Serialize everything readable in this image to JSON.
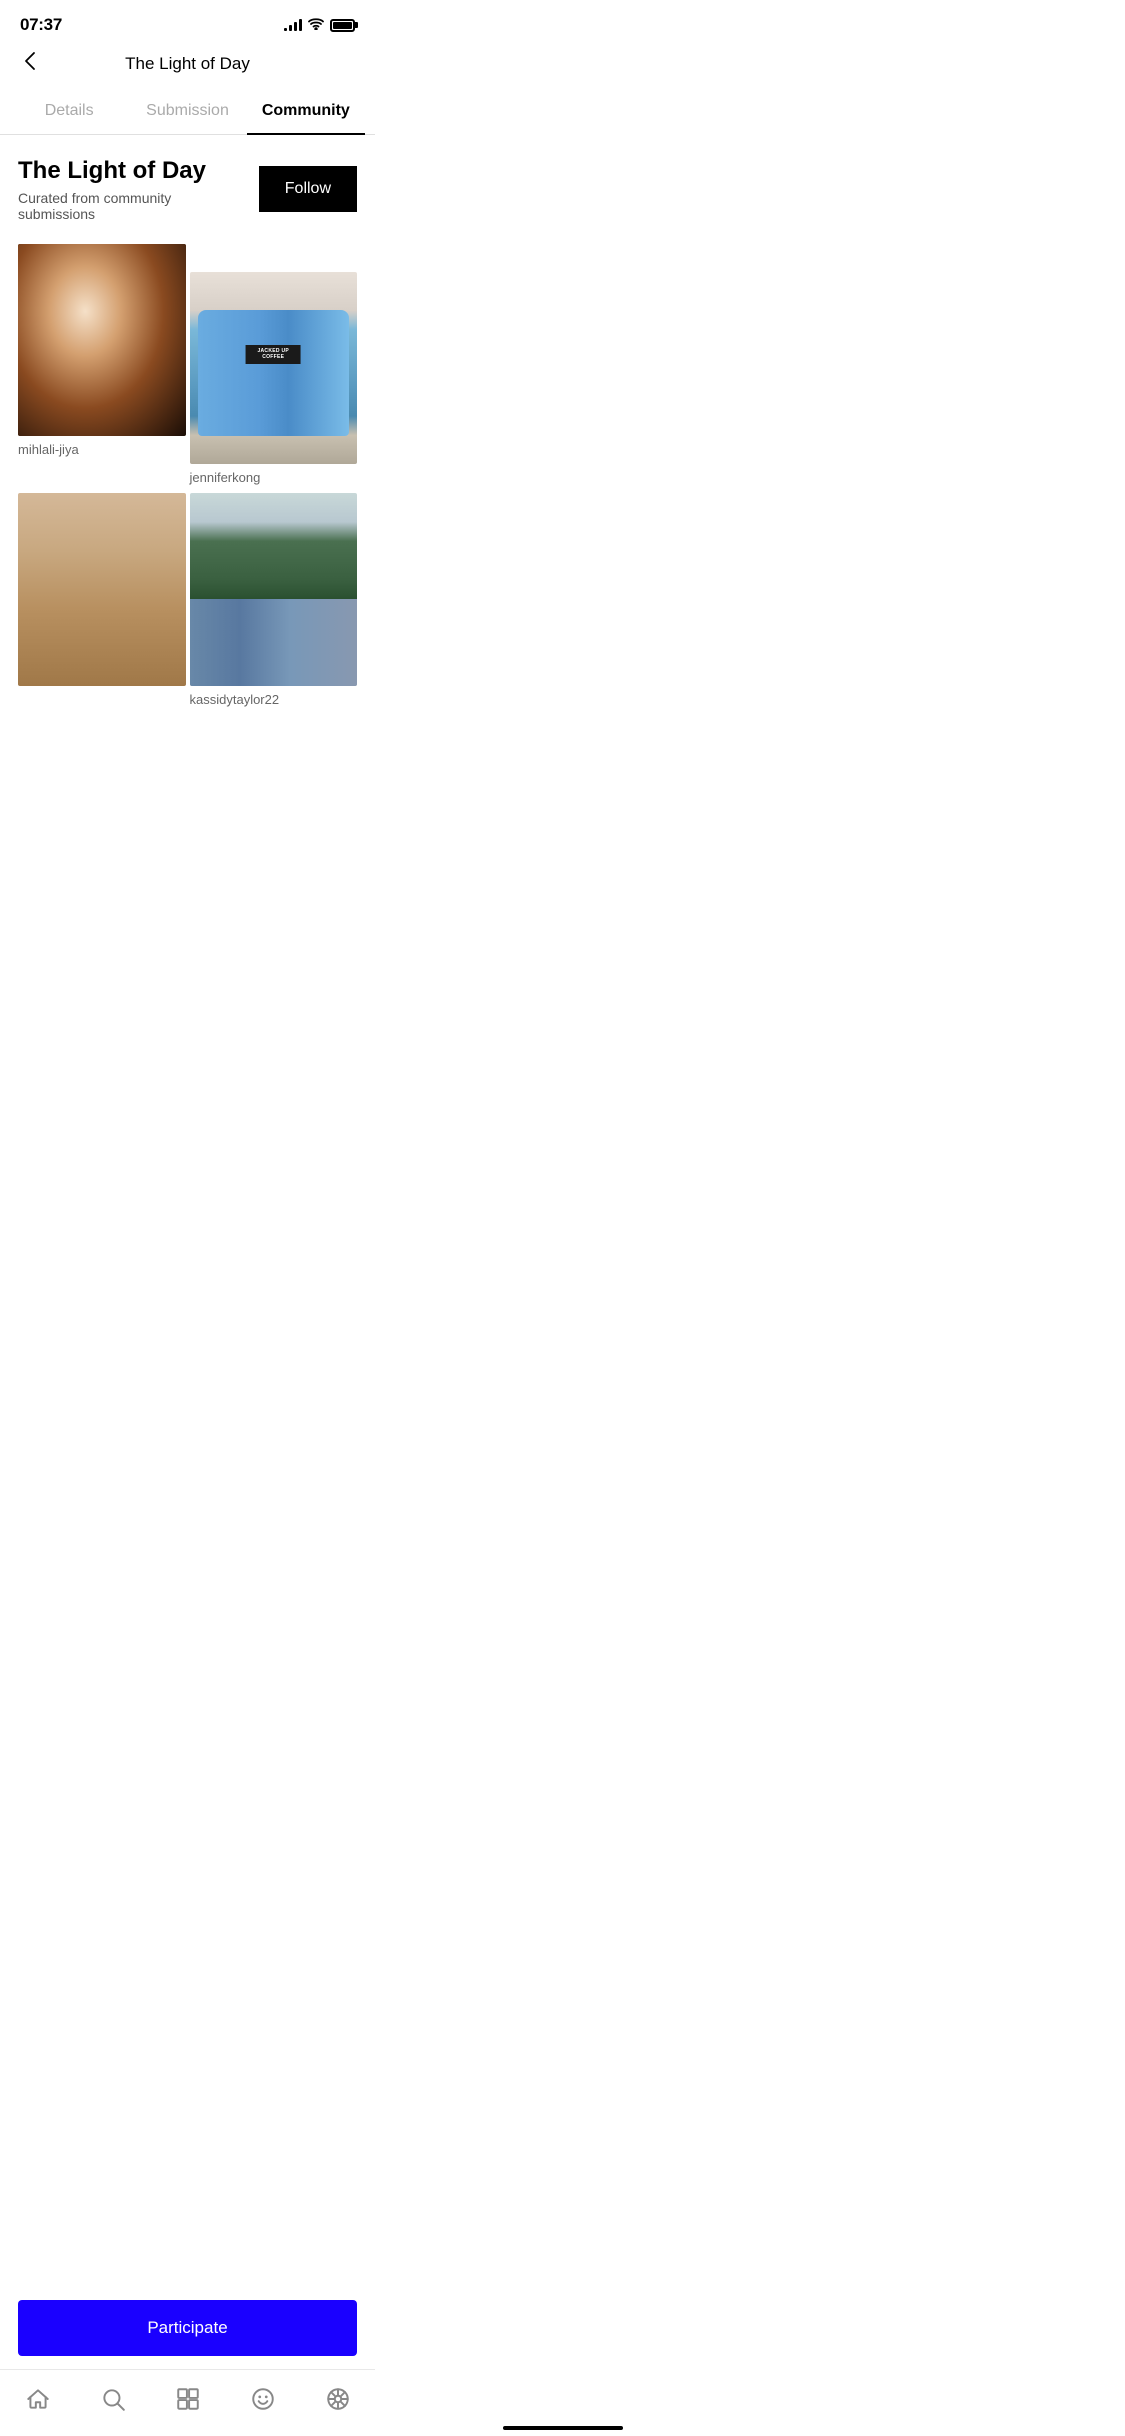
{
  "statusBar": {
    "time": "07:37"
  },
  "header": {
    "title": "The Light of Day",
    "backLabel": "<"
  },
  "tabs": [
    {
      "label": "Details",
      "active": false
    },
    {
      "label": "Submission",
      "active": false
    },
    {
      "label": "Community",
      "active": true
    }
  ],
  "community": {
    "title": "The Light of Day",
    "subtitle": "Curated from community submissions",
    "followLabel": "Follow"
  },
  "photos": [
    {
      "username": "mihlali-jiya",
      "photoClass": "photo-1",
      "side": "left"
    },
    {
      "username": "jenniferkong",
      "photoClass": "photo-2",
      "side": "right"
    },
    {
      "username": "",
      "photoClass": "photo-3",
      "side": "left"
    },
    {
      "username": "kassidytaylor22",
      "photoClass": "photo-4",
      "side": "right"
    }
  ],
  "participate": {
    "label": "Participate"
  },
  "nav": [
    {
      "name": "home",
      "icon": "home"
    },
    {
      "name": "search",
      "icon": "search"
    },
    {
      "name": "collections",
      "icon": "collections"
    },
    {
      "name": "emoji",
      "icon": "emoji"
    },
    {
      "name": "wheel",
      "icon": "wheel"
    }
  ]
}
